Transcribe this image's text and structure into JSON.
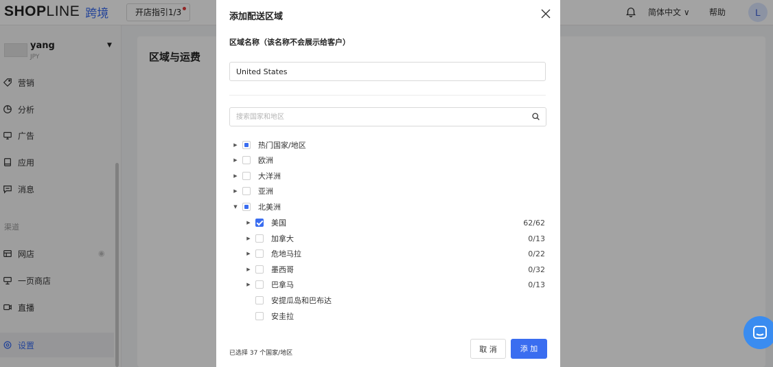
{
  "topbar": {
    "brand_a": "SHOP",
    "brand_b": "LINE",
    "brand_cn": "跨境",
    "guide": "开店指引1/3",
    "language": "简体中文 ∨",
    "help": "帮助",
    "avatar": "L"
  },
  "sidebar": {
    "store_name": "yang",
    "store_currency": "JPY",
    "items": [
      {
        "label": "营销",
        "icon": "tag-icon"
      },
      {
        "label": "分析",
        "icon": "chart-pie-icon"
      },
      {
        "label": "广告",
        "icon": "monitor-icon"
      },
      {
        "label": "应用",
        "icon": "app-icon"
      },
      {
        "label": "消息",
        "icon": "message-icon"
      }
    ],
    "section_label": "渠道",
    "channels": [
      {
        "label": "网店",
        "icon": "store-icon"
      },
      {
        "label": "一页商店",
        "icon": "single-page-icon"
      },
      {
        "label": "直播",
        "icon": "live-icon"
      }
    ],
    "settings": "设置"
  },
  "main": {
    "title": "区域与运费"
  },
  "modal": {
    "title": "添加配送区域",
    "name_label": "区域名称（该名称不会展示给客户）",
    "name_value": "United States",
    "search_placeholder": "搜索国家和地区",
    "tree": [
      {
        "label": "热门国家/地区",
        "state": "partial",
        "expandable": true,
        "level": 0
      },
      {
        "label": "欧洲",
        "state": "unchecked",
        "expandable": true,
        "level": 0
      },
      {
        "label": "大洋洲",
        "state": "unchecked",
        "expandable": true,
        "level": 0
      },
      {
        "label": "亚洲",
        "state": "unchecked",
        "expandable": true,
        "level": 0
      },
      {
        "label": "北美洲",
        "state": "partial",
        "expandable": true,
        "expanded": true,
        "level": 0
      },
      {
        "label": "美国",
        "state": "checked",
        "expandable": true,
        "level": 1,
        "count": "62/62"
      },
      {
        "label": "加拿大",
        "state": "unchecked",
        "expandable": true,
        "level": 1,
        "count": "0/13"
      },
      {
        "label": "危地马拉",
        "state": "unchecked",
        "expandable": true,
        "level": 1,
        "count": "0/22"
      },
      {
        "label": "墨西哥",
        "state": "unchecked",
        "expandable": true,
        "level": 1,
        "count": "0/32"
      },
      {
        "label": "巴拿马",
        "state": "unchecked",
        "expandable": true,
        "level": 1,
        "count": "0/13"
      },
      {
        "label": "安提瓜岛和巴布达",
        "state": "unchecked",
        "expandable": false,
        "level": 1
      },
      {
        "label": "安圭拉",
        "state": "unchecked",
        "expandable": false,
        "level": 1
      }
    ],
    "selected_text": "已选择 37 个国家/地区",
    "cancel": "取 消",
    "add": "添 加"
  },
  "colors": {
    "accent": "#3a6df0",
    "overlay": "rgba(0,0,0,0.36)"
  }
}
